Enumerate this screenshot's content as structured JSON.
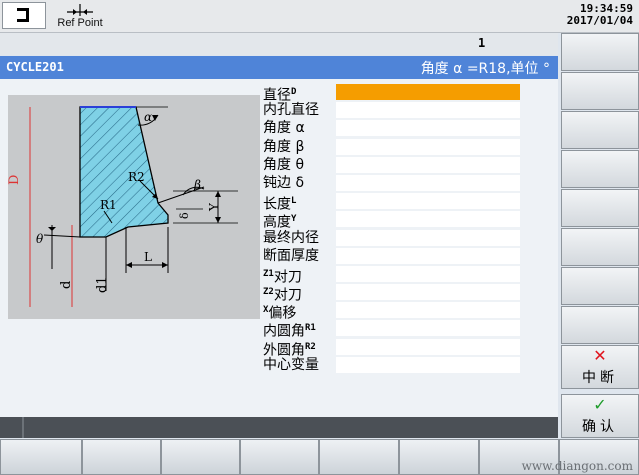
{
  "topbar": {
    "ref_point_label": "Ref Point",
    "time": "19:34:59",
    "date": "2017/01/04"
  },
  "channel_number": "1",
  "title": {
    "cycle": "CYCLE201",
    "info": "角度 α =R18,单位 °"
  },
  "drawing_labels": {
    "alpha": "α",
    "beta": "β",
    "theta": "θ",
    "R1": "R1",
    "R2": "R2",
    "D": "D",
    "d": "d",
    "d1": "d1",
    "L": "L",
    "Y": "Y",
    "delta": "δ"
  },
  "fields": [
    {
      "label": "直径",
      "sup": "D",
      "value": ""
    },
    {
      "label": "内孔直径",
      "sup": "",
      "value": ""
    },
    {
      "label": "角度 α",
      "sup": "",
      "value": ""
    },
    {
      "label": "角度 β",
      "sup": "",
      "value": ""
    },
    {
      "label": "角度 θ",
      "sup": "",
      "value": ""
    },
    {
      "label": "钝边 δ",
      "sup": "",
      "value": ""
    },
    {
      "label": "长度",
      "sup": "L",
      "value": ""
    },
    {
      "label": "高度",
      "sup": "Y",
      "value": ""
    },
    {
      "label": "最终内径",
      "sup": "",
      "value": ""
    },
    {
      "label": "断面厚度",
      "sup": "",
      "value": ""
    },
    {
      "label": "对刀",
      "pre": "Z1",
      "sup": "",
      "value": ""
    },
    {
      "label": "对刀",
      "pre": "Z2",
      "sup": "",
      "value": ""
    },
    {
      "label": "偏移",
      "pre": "X",
      "sup": "",
      "value": ""
    },
    {
      "label": "内圆角",
      "sup": "R1",
      "value": ""
    },
    {
      "label": "外圆角",
      "sup": "R2",
      "value": ""
    },
    {
      "label": "中心变量",
      "sup": "",
      "value": ""
    }
  ],
  "softkeys": {
    "cancel_label": "中断",
    "confirm_label": "确认"
  },
  "watermark": "www.diangon.com",
  "colors": {
    "title_bar": "#4f84d8",
    "active_field": "#f59d00",
    "hatch": "#7fd1e6",
    "cancel_mark": "#e0141e",
    "confirm_mark": "#1e9c2a"
  }
}
